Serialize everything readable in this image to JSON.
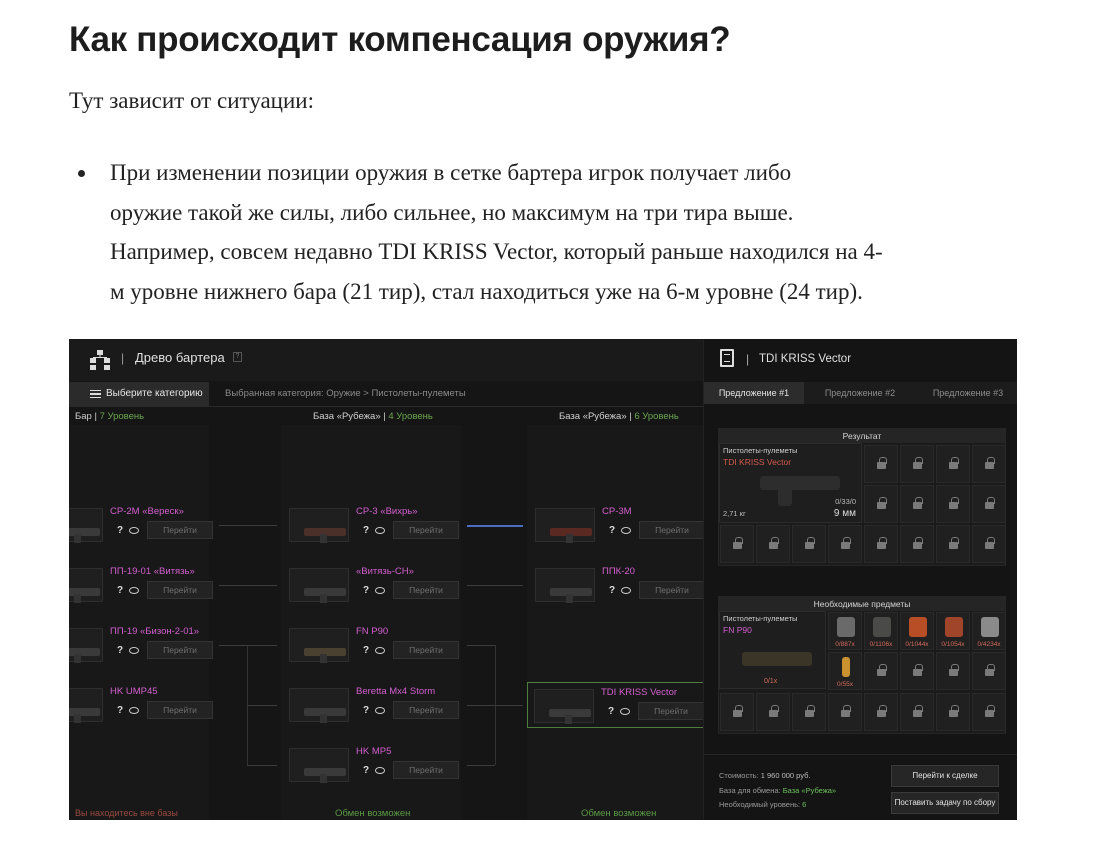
{
  "article": {
    "heading": "Как происходит компенсация оружия?",
    "intro": "Тут зависит от ситуации:",
    "bullet_line1": "При изменении позиции оружия в сетке бартера игрок получает либо",
    "bullet_line2": "оружие такой же силы, либо сильнее, но максимум на три тира выше.",
    "bullet_line3": "Например, совсем недавно TDI KRISS Vector, который раньше находился на 4-",
    "bullet_line4": "м уровне нижнего бара (21 тир), стал находиться уже на 6-м уровне (24 тир)."
  },
  "game": {
    "top_sep": "|",
    "title": "Древо бартера",
    "help_mark": "?",
    "category_button": "Выберите категорию",
    "breadcrumb": "Выбранная категория: Оружие > Пистолеты-пулеметы",
    "columns": [
      {
        "name": "Бар",
        "sep": " | ",
        "level": "7 Уровень"
      },
      {
        "name": "База «Рубежа»",
        "sep": " | ",
        "level": "4 Уровень"
      },
      {
        "name": "База «Рубежа»",
        "sep": " | ",
        "level": "6 Уровень"
      }
    ],
    "card_q": "?",
    "go_label": "Перейти",
    "col1_items": [
      "СР-2М «Вереск»",
      "ПП-19-01 «Витязь»",
      "ПП-19 «Бизон-2-01»",
      "HK UMP45"
    ],
    "col2_items": [
      "СР-3 «Вихрь»",
      "«Витязь-СН»",
      "FN P90",
      "Beretta Mx4 Storm",
      "HK MP5"
    ],
    "col3_items": [
      "СР-3М",
      "ППК-20",
      "TDI KRISS Vector"
    ],
    "bottom_left": "Вы находитесь вне базы",
    "bottom_mid": "Обмен возможен",
    "bottom_right": "Обмен возможен",
    "colors": {
      "accent_pink": "#d45fd0",
      "level_green": "#6aa84f",
      "selected_border": "#4e7d3e",
      "link_blue": "#4b6dbf"
    }
  },
  "panel": {
    "sep": "|",
    "title": "TDI KRISS Vector",
    "tabs": [
      "Предложение #1",
      "Предложение #2",
      "Предложение #3"
    ],
    "result_header": "Результат",
    "result_item": {
      "category": "Пистолеты-пулеметы",
      "name": "TDI KRISS Vector",
      "weight": "2,71 кг",
      "ammo": "0/33/0",
      "caliber": "9 мм"
    },
    "required_header": "Необходимые предметы",
    "required_item": {
      "category": "Пистолеты-пулеметы",
      "name": "FN P90",
      "count": "0/1x"
    },
    "resources": [
      {
        "count": "0/887x",
        "icon": "casing-icon",
        "color": "#6a6a6a"
      },
      {
        "count": "0/1106x",
        "icon": "scrap-icon",
        "color": "#4a4a48"
      },
      {
        "count": "0/1044x",
        "icon": "shard-icon",
        "color": "#b84e26"
      },
      {
        "count": "0/1054x",
        "icon": "crystal-icon",
        "color": "#a0442a"
      },
      {
        "count": "0/4234x",
        "icon": "ore-icon",
        "color": "#8a8a8a"
      },
      {
        "count": "0/55x",
        "icon": "vial-icon",
        "color": "#c9922e"
      }
    ],
    "cost_label": "Стоимость:",
    "cost_value": "1 960 000 руб.",
    "base_label": "База для обмена:",
    "base_value": "База «Рубежа»",
    "level_label": "Необходимый уровень:",
    "level_value": "6",
    "go_deal_button": "Перейти к сделке",
    "task_button": "Поставить задачу по сбору"
  }
}
